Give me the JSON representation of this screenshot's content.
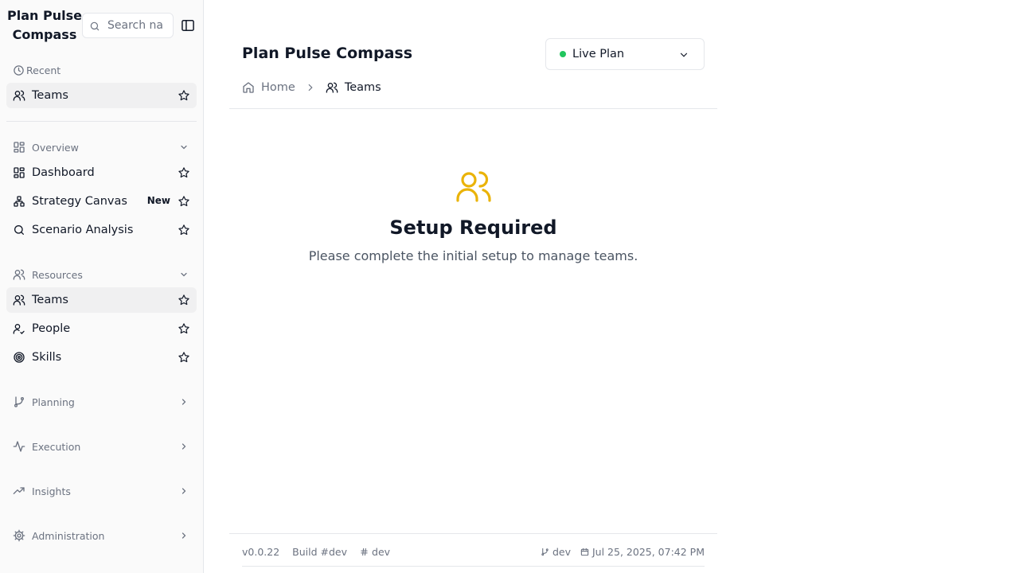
{
  "app": {
    "title": "Plan Pulse Compass"
  },
  "search": {
    "placeholder": "Search na"
  },
  "sidebar": {
    "recent": {
      "label": "Recent",
      "items": [
        {
          "label": "Teams",
          "icon": "users-icon"
        }
      ]
    },
    "sections": [
      {
        "label": "Overview",
        "expanded": true,
        "items": [
          {
            "label": "Dashboard",
            "icon": "layout-grid-icon"
          },
          {
            "label": "Strategy Canvas",
            "icon": "workflow-icon",
            "badge": "New"
          },
          {
            "label": "Scenario Analysis",
            "icon": "search-icon"
          }
        ]
      },
      {
        "label": "Resources",
        "expanded": true,
        "items": [
          {
            "label": "Teams",
            "icon": "users-icon",
            "active": true
          },
          {
            "label": "People",
            "icon": "user-check-icon"
          },
          {
            "label": "Skills",
            "icon": "target-icon"
          }
        ]
      },
      {
        "label": "Planning",
        "expanded": false
      },
      {
        "label": "Execution",
        "expanded": false
      },
      {
        "label": "Insights",
        "expanded": false
      },
      {
        "label": "Administration",
        "expanded": false
      }
    ]
  },
  "header": {
    "title": "Plan Pulse Compass",
    "plan_selector": {
      "value": "Live Plan",
      "status_color": "#22c55e"
    }
  },
  "breadcrumb": [
    {
      "label": "Home",
      "icon": "home-icon"
    },
    {
      "label": "Teams",
      "icon": "users-icon"
    }
  ],
  "empty_state": {
    "icon": "users-icon",
    "icon_color": "#eab308",
    "title": "Setup Required",
    "message": "Please complete the initial setup to manage teams."
  },
  "footer": {
    "version": "v0.0.22",
    "build": "Build #dev",
    "commit": "dev",
    "branch": "dev",
    "date": "Jul 25, 2025, 07:42 PM"
  }
}
